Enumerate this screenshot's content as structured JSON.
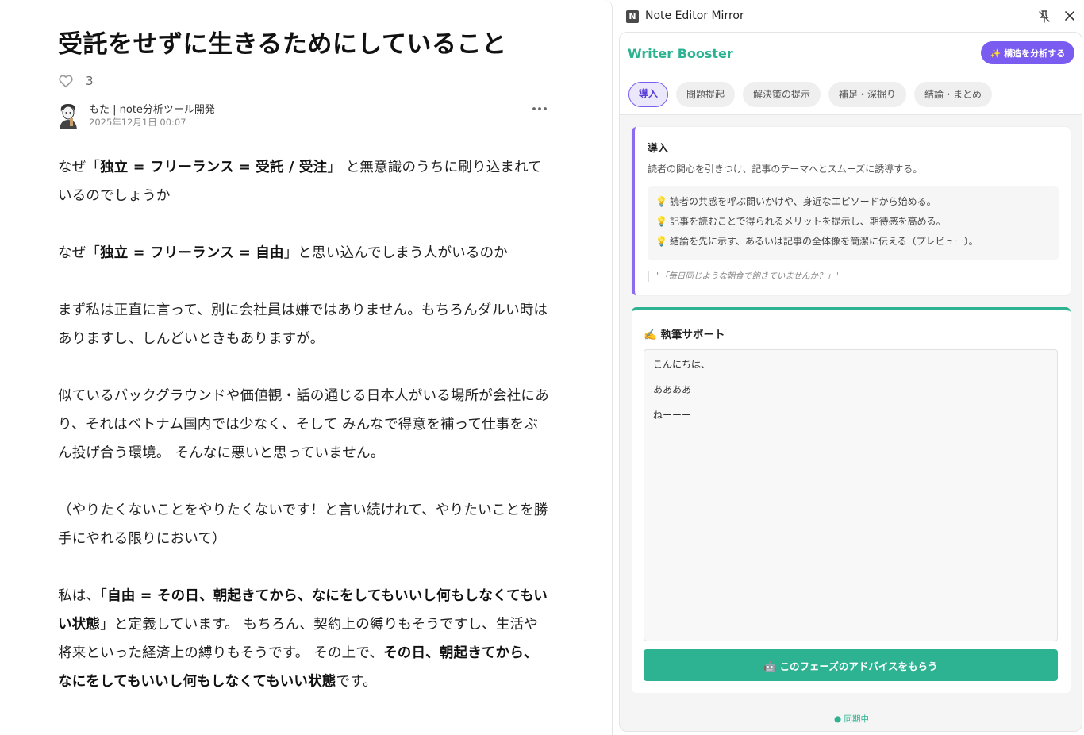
{
  "article": {
    "title": "受託をせずに生きるためにしていること",
    "likes": "3",
    "author_name": "もた | note分析ツール開発",
    "date": "2025年12月1日 00:07",
    "paragraphs": [
      [
        {
          "t": "なぜ「"
        },
        {
          "t": "独立 = フリーランス = 受託 / 受注",
          "b": true
        },
        {
          "t": "」 と無意識のうちに刷り込まれているのでしょうか"
        }
      ],
      [
        {
          "t": "なぜ「"
        },
        {
          "t": "独立 = フリーランス = 自由",
          "b": true
        },
        {
          "t": "」と思い込んでしまう人がいるのか"
        }
      ],
      [
        {
          "t": "まず私は正直に言って、別に会社員は嫌ではありません。もちろんダルい時はありますし、しんどいときもありますが。"
        }
      ],
      [
        {
          "t": "似ているバックグラウンドや価値観・話の通じる日本人がいる場所が会社にあり、それはベトナム国内では少なく、そして みんなで得意を補って仕事をぶん投げ合う環境。 そんなに悪いと思っていません。"
        }
      ],
      [
        {
          "t": "（やりたくないことをやりたくないです！と言い続けれて、やりたいことを勝手にやれる限りにおいて）"
        }
      ],
      [
        {
          "t": "私は、「"
        },
        {
          "t": "自由 = その日、朝起きてから、なにをしてもいいし何もしなくてもいい状態",
          "b": true
        },
        {
          "t": "」と定義しています。 もちろん、契約上の縛りもそうですし、生活や将来といった経済上の縛りもそうです。 その上で、"
        },
        {
          "t": "その日、朝起きてから、なにをしてもいいし何もしなくてもいい状態",
          "b": true
        },
        {
          "t": "です。"
        }
      ]
    ]
  },
  "sidepanel": {
    "title": "Note Editor Mirror",
    "logo": "N",
    "app_name": "Writer Booster",
    "analyze_button": "✨ 構造を分析する",
    "tabs": [
      {
        "label": "導入",
        "active": true
      },
      {
        "label": "問題提起",
        "active": false
      },
      {
        "label": "解決策の提示",
        "active": false
      },
      {
        "label": "補足・深掘り",
        "active": false
      },
      {
        "label": "結論・まとめ",
        "active": false
      }
    ],
    "phase": {
      "title": "導入",
      "description": "読者の関心を引きつけ、記事のテーマへとスムーズに誘導する。",
      "tips": [
        "読者の共感を呼ぶ問いかけや、身近なエピソードから始める。",
        "記事を読むことで得られるメリットを提示し、期待感を高める。",
        "結論を先に示す、あるいは記事の全体像を簡潔に伝える（プレビュー）。"
      ],
      "example": "\"「毎日同じような朝食で飽きていませんか？」\""
    },
    "support": {
      "title": "✍️ 執筆サポート",
      "editor_lines": [
        "こんにちは、",
        "ああああ",
        "ねーーー"
      ],
      "advice_button": "🤖 このフェーズのアドバイスをもらう"
    },
    "status": "● 同期中"
  },
  "colors": {
    "accent_green": "#2db391",
    "accent_purple": "#7b5cf0",
    "bulb": "#f2c230"
  }
}
